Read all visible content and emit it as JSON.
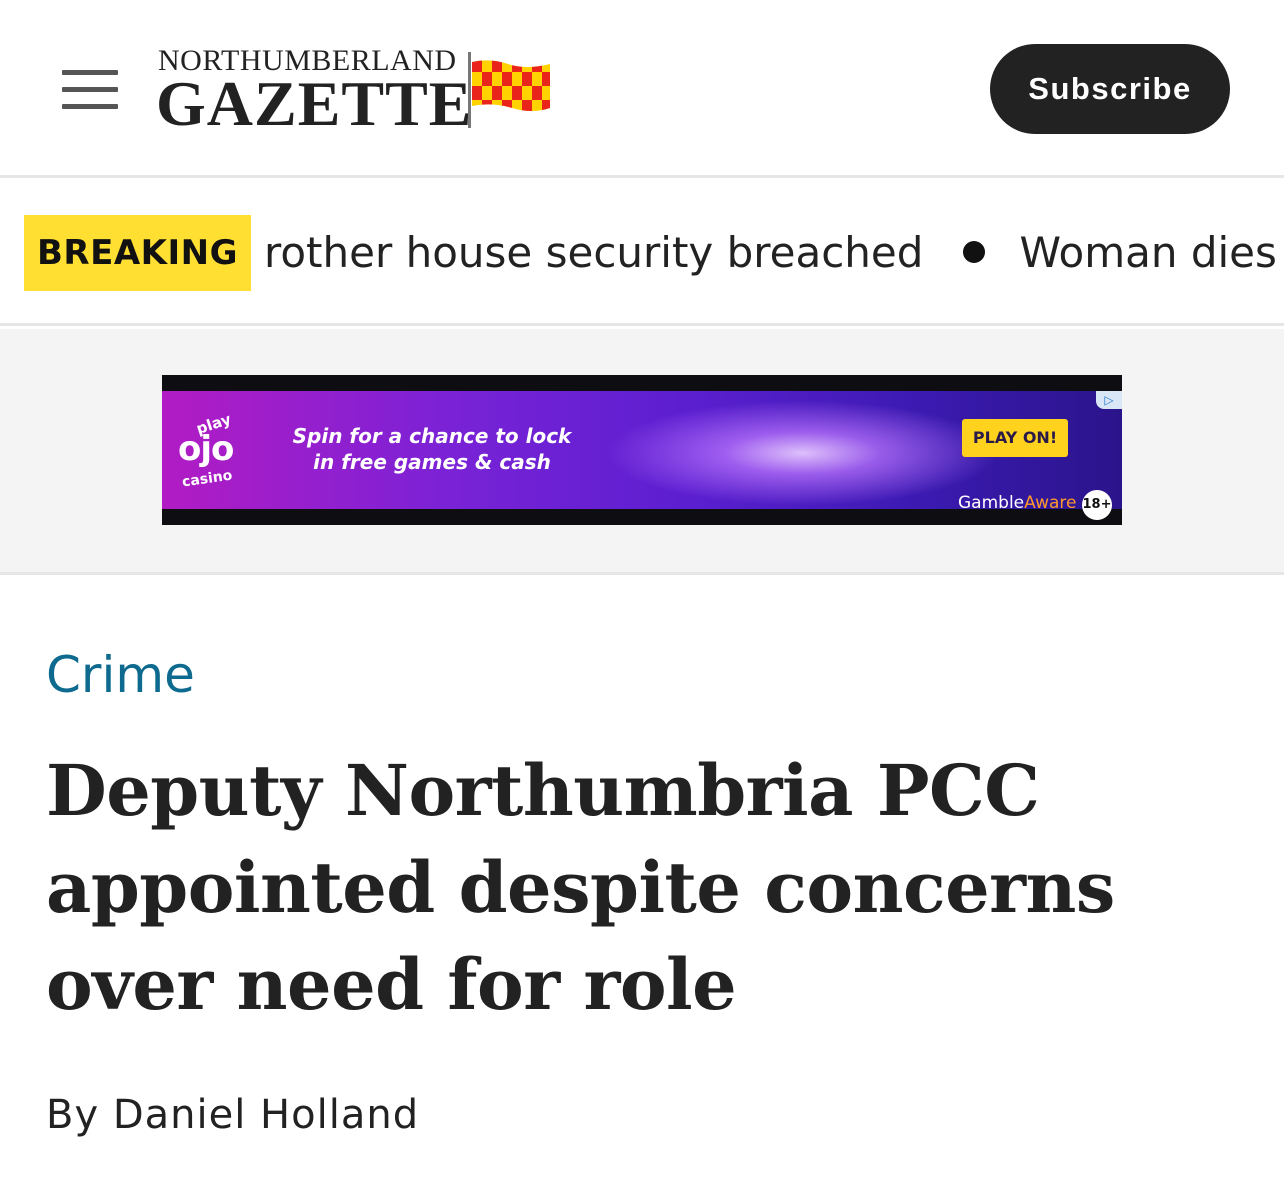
{
  "header": {
    "menu_icon": "hamburger-menu-icon",
    "logo": {
      "top_line": "NORTHUMBERLAND",
      "main_line": "GAZETTE",
      "flag_icon": "northumberland-flag-icon",
      "flag_colors": [
        "#e8241b",
        "#ffd200"
      ]
    },
    "subscribe_label": "Subscribe"
  },
  "breaking": {
    "badge_label": "BREAKING",
    "items": [
      "rother house security breached",
      "Woman dies in"
    ]
  },
  "ad": {
    "brand_play": "play",
    "brand_name": "ojo",
    "brand_casino": "casino",
    "copy_line1": "Spin for a chance to lock",
    "copy_line2": "in free games & cash",
    "cta_label": "PLAY ON!",
    "gamble_word": "Gamble",
    "aware_word": "Aware",
    "age_label": "18+",
    "adchoices_icon": "adchoices-icon"
  },
  "article": {
    "category": "Crime",
    "headline": "Deputy Northumbria PCC appointed despite concerns over need for role",
    "byline_prefix": "By",
    "author": "Daniel Holland"
  },
  "colors": {
    "category_link": "#0e6a8e",
    "breaking_badge": "#ffe032",
    "subscribe_button": "#222222"
  }
}
